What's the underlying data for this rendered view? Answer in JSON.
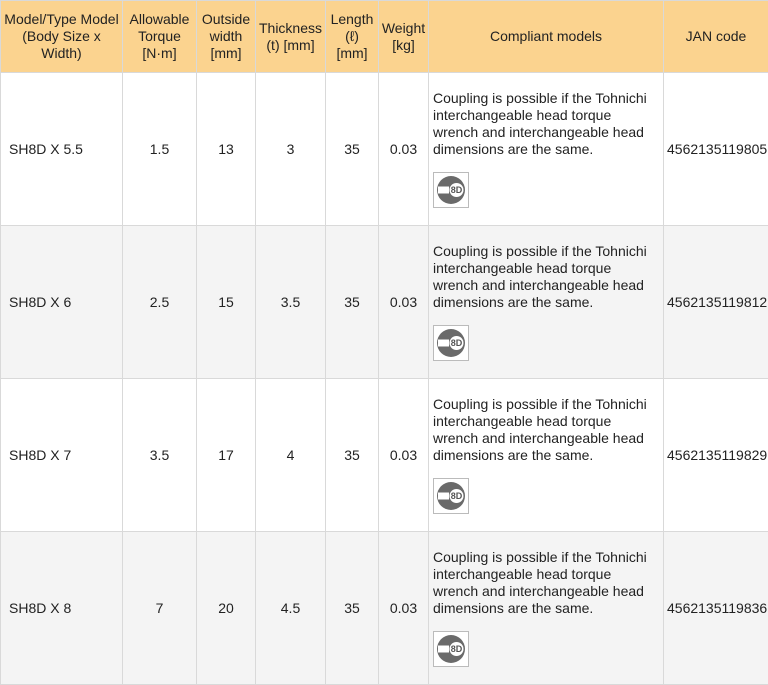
{
  "headers": [
    "Model/Type Model (Body Size x Width)",
    "Allowable Torque [N·m]",
    "Outside width [mm]",
    "Thickness (t) [mm]",
    "Length (ℓ) [mm]",
    "Weight [kg]",
    "Compliant models",
    "JAN code"
  ],
  "rows": [
    {
      "model": "SH8D X 5.5",
      "torque": "1.5",
      "width": "13",
      "thickness": "3",
      "length": "35",
      "weight": "0.03",
      "compliant": "Coupling is possible if the Tohnichi interchangeable head torque wrench and interchangeable head dimensions are the same.",
      "badge": "8D",
      "jan": "4562135119805"
    },
    {
      "model": "SH8D X 6",
      "torque": "2.5",
      "width": "15",
      "thickness": "3.5",
      "length": "35",
      "weight": "0.03",
      "compliant": "Coupling is possible if the Tohnichi interchangeable head torque wrench and interchangeable head dimensions are the same.",
      "badge": "8D",
      "jan": "4562135119812"
    },
    {
      "model": "SH8D X 7",
      "torque": "3.5",
      "width": "17",
      "thickness": "4",
      "length": "35",
      "weight": "0.03",
      "compliant": "Coupling is possible if the Tohnichi interchangeable head torque wrench and interchangeable head dimensions are the same.",
      "badge": "8D",
      "jan": "4562135119829"
    },
    {
      "model": "SH8D X 8",
      "torque": "7",
      "width": "20",
      "thickness": "4.5",
      "length": "35",
      "weight": "0.03",
      "compliant": "Coupling is possible if the Tohnichi interchangeable head torque wrench and interchangeable head dimensions are the same.",
      "badge": "8D",
      "jan": "4562135119836"
    }
  ],
  "colors": {
    "header_bg": "#fbd38f",
    "alt_row_bg": "#f4f4f4",
    "border": "#d9d9d9"
  },
  "icons": {
    "badge": "head-8d-icon"
  }
}
